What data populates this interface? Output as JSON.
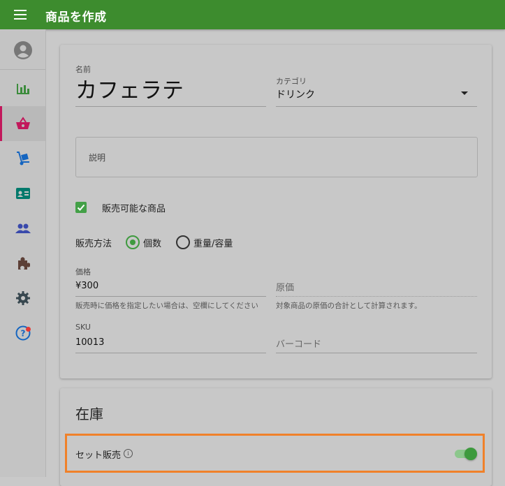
{
  "header": {
    "title": "商品を作成",
    "menu_icon": "hamburger-menu-icon"
  },
  "sidebar": {
    "items": [
      {
        "name": "account",
        "icon": "account-circle-icon"
      },
      {
        "name": "reports",
        "icon": "bar-chart-icon"
      },
      {
        "name": "products",
        "icon": "shopping-basket-icon",
        "active": true
      },
      {
        "name": "inventory",
        "icon": "hand-truck-icon"
      },
      {
        "name": "customers",
        "icon": "contact-card-icon"
      },
      {
        "name": "staff",
        "icon": "people-icon"
      },
      {
        "name": "addons",
        "icon": "puzzle-piece-icon"
      },
      {
        "name": "settings",
        "icon": "gear-icon"
      },
      {
        "name": "help",
        "icon": "help-circle-icon",
        "badge": true
      }
    ]
  },
  "product": {
    "name_label": "名前",
    "name_value": "カフェラテ",
    "category_label": "カテゴリ",
    "category_value": "ドリンク",
    "description_placeholder": "説明",
    "sellable_label": "販売可能な商品",
    "sellable_checked": true,
    "sale_method_label": "販売方法",
    "sale_method_options": [
      "個数",
      "重量/容量"
    ],
    "sale_method_selected": "個数",
    "price_label": "価格",
    "price_value": "¥300",
    "price_hint": "販売時に価格を指定したい場合は、空欄にしてください",
    "cost_placeholder": "原価",
    "cost_hint": "対象商品の原価の合計として計算されます。",
    "sku_label": "SKU",
    "sku_value": "10013",
    "barcode_placeholder": "バーコード"
  },
  "inventory": {
    "title": "在庫",
    "set_sale_label": "セット販売",
    "set_sale_enabled": true
  },
  "colors": {
    "appbar": "#3d8c2e",
    "active_nav": "#c2185b",
    "accent_green": "#43a047",
    "highlight_border": "#f0812a"
  }
}
